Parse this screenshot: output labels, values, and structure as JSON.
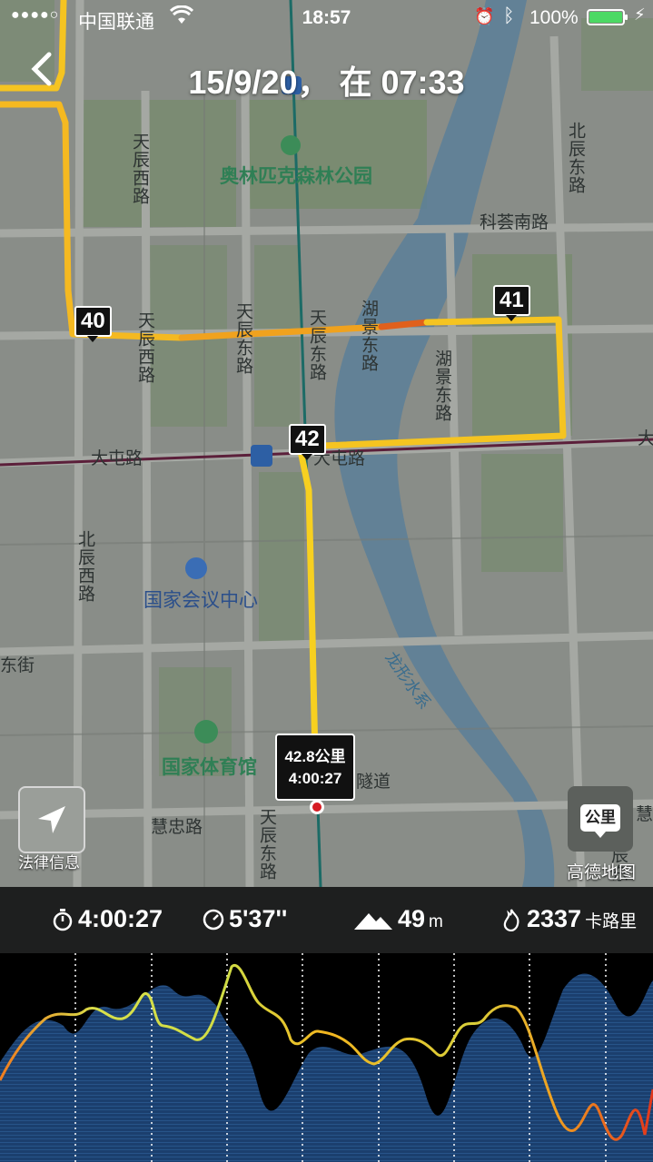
{
  "status_bar": {
    "signal": "●●●●○",
    "carrier": "中国联通",
    "time": "18:57",
    "battery": "100%",
    "battery_level": 1.0
  },
  "header": {
    "back_icon": "chevron-left-icon",
    "title": "15/9/20， 在 07:33"
  },
  "map": {
    "road_labels": [
      "天辰西路",
      "北辰东路",
      "科荟南路",
      "天辰西路",
      "天辰东路",
      "天辰东路",
      "湖景东路",
      "湖景东路",
      "大屯路",
      "大屯路",
      "大",
      "北辰西路",
      "东街",
      "慧忠路",
      "慧",
      "天辰东路",
      "隧道",
      "北辰东路"
    ],
    "pois": [
      "奥林匹克森林公园",
      "国家会议中心",
      "国家体育馆"
    ],
    "water_label": "龙形水系",
    "km_markers": [
      "40",
      "41",
      "42"
    ],
    "end_callout": {
      "distance": "42.8公里",
      "time": "4:00:27"
    },
    "locate_button_icon": "navigation-arrow-icon",
    "legal_label": "法律信息",
    "unit_button_label": "公里",
    "provider_logo": "高德地图"
  },
  "stats": {
    "duration": "4:00:27",
    "pace": "5'37''",
    "elevation": "49",
    "elevation_unit": "m",
    "calories": "2337",
    "calories_unit": "卡路里"
  },
  "colors": {
    "route_yellow": "#f5c421",
    "route_orange": "#ee8a1c",
    "route_red": "#d6401c",
    "elevation_fill": "#1b3f6e",
    "pace_green": "#9be04b"
  }
}
